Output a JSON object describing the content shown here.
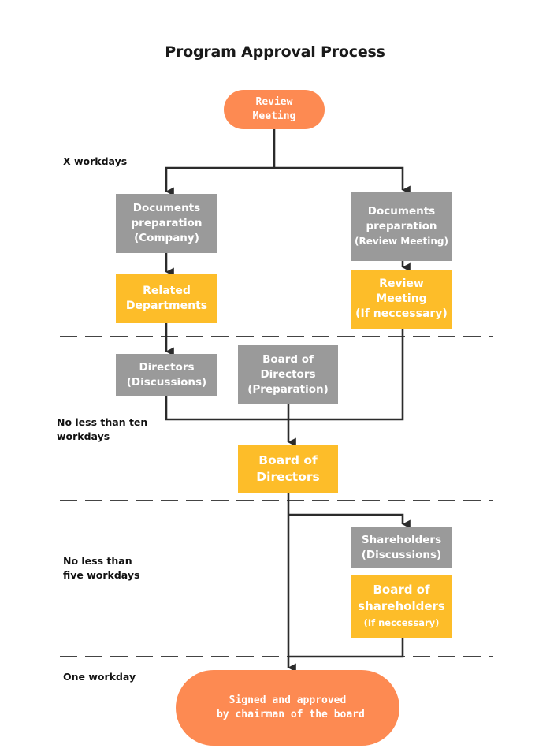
{
  "title": "Program Approval Process",
  "colors": {
    "terminal": "#fd8a52",
    "process_gray": "#9a9a9a",
    "process_yellow": "#fdbd29",
    "connector": "#2b2b2b",
    "divider": "#444444"
  },
  "phases": [
    {
      "label": "X workdays"
    },
    {
      "label": "No less than ten\nworkdays"
    },
    {
      "label": "No less than\nfive workdays"
    },
    {
      "label": "One workday"
    }
  ],
  "nodes": {
    "start": {
      "lines": [
        "Review",
        "Meeting"
      ],
      "type": "terminal"
    },
    "docs_company": {
      "lines": [
        "Documents",
        "preparation",
        "(Company)"
      ],
      "type": "process-gray"
    },
    "related_departments": {
      "lines": [
        "Related",
        "Departments"
      ],
      "type": "process-yellow"
    },
    "docs_review": {
      "lines": [
        "Documents",
        "preparation",
        "(Review Meeting)"
      ],
      "type": "process-gray"
    },
    "review_meeting_optional": {
      "lines": [
        "Review",
        "Meeting",
        "(If neccessary)"
      ],
      "type": "process-yellow"
    },
    "directors_discussions": {
      "lines": [
        "Directors",
        "(Discussions)"
      ],
      "type": "process-gray"
    },
    "board_prep": {
      "lines": [
        "Board of",
        "Directors",
        "(Preparation)"
      ],
      "type": "process-gray"
    },
    "board_of_directors": {
      "lines": [
        "Board of",
        "Directors"
      ],
      "type": "process-yellow"
    },
    "shareholders_discussions": {
      "lines": [
        "Shareholders",
        "(Discussions)"
      ],
      "type": "process-gray"
    },
    "board_of_shareholders": {
      "lines": [
        "Board of",
        "shareholders",
        "(If neccessary)"
      ],
      "type": "process-yellow"
    },
    "end": {
      "lines": [
        "Signed and approved",
        " by chairman of the board"
      ],
      "type": "terminal"
    }
  },
  "edges": [
    {
      "from": "start",
      "to": "docs_company"
    },
    {
      "from": "start",
      "to": "docs_review"
    },
    {
      "from": "docs_company",
      "to": "related_departments"
    },
    {
      "from": "docs_review",
      "to": "review_meeting_optional"
    },
    {
      "from": "related_departments",
      "to": "directors_discussions"
    },
    {
      "from": "directors_discussions",
      "to": "board_of_directors"
    },
    {
      "from": "board_prep",
      "to": "board_of_directors"
    },
    {
      "from": "review_meeting_optional",
      "to": "board_of_directors"
    },
    {
      "from": "board_of_directors",
      "to": "shareholders_discussions"
    },
    {
      "from": "board_of_directors",
      "to": "end"
    },
    {
      "from": "board_of_shareholders",
      "to": "end"
    }
  ]
}
